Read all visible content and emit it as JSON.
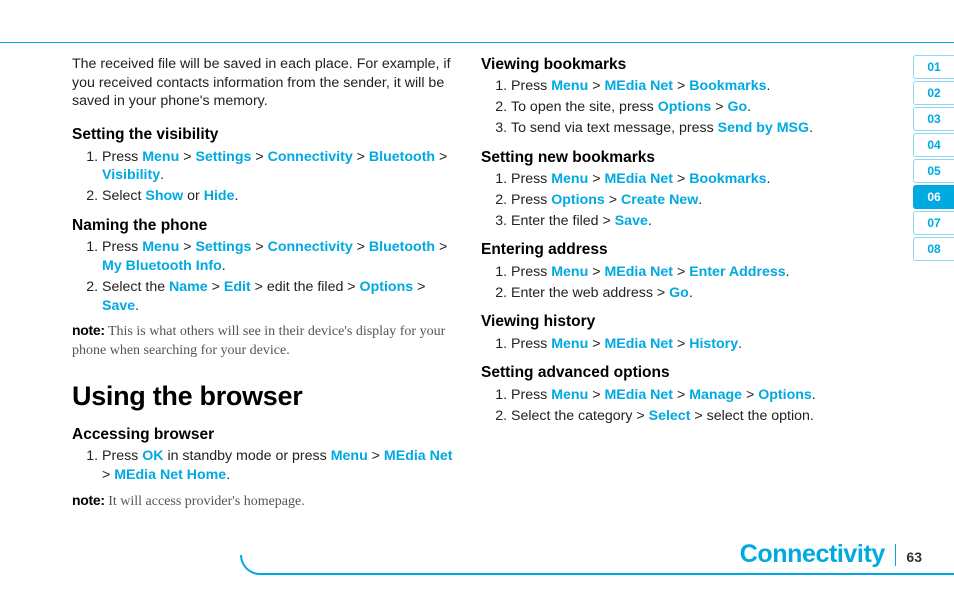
{
  "intro": "The received file will be saved in each place. For example, if you received contacts information from the sender, it will be saved in your phone's memory.",
  "left": {
    "visibility": {
      "head": "Setting the visibility",
      "s1_pre": "Press ",
      "s1_k1": "Menu",
      "s1_k2": "Settings",
      "s1_k3": "Connectivity",
      "s1_k4": "Bluetooth",
      "s1_k5": "Visibility",
      "s2_pre": "Select ",
      "s2_k1": "Show",
      "s2_or": " or ",
      "s2_k2": "Hide"
    },
    "naming": {
      "head": "Naming the phone",
      "s1_pre": "Press ",
      "s1_k1": "Menu",
      "s1_k2": "Settings",
      "s1_k3": "Connectivity",
      "s1_k4": "Bluetooth",
      "s1_k5": "My Bluetooth Info",
      "s2_pre": "Select the ",
      "s2_k1": "Name",
      "s2_k2": "Edit",
      "s2_mid": " > edit the filed > ",
      "s2_k3": "Options",
      "s2_k4": "Save",
      "note_label": "note:",
      "note": " This is what others will see in their device's display for your phone when searching for your device."
    },
    "browser_title": "Using the browser",
    "access": {
      "head": "Accessing browser",
      "s1_pre": "Press ",
      "s1_k1": "OK",
      "s1_mid": " in standby mode or press ",
      "s1_k2": "Menu",
      "s1_k3": "MEdia Net",
      "s1_k4": "MEdia Net Home",
      "note_label": "note:",
      "note": " It will access provider's homepage."
    }
  },
  "right": {
    "viewbm": {
      "head": "Viewing bookmarks",
      "s1_pre": "Press ",
      "s1_k1": "Menu",
      "s1_k2": "MEdia Net",
      "s1_k3": "Bookmarks",
      "s2_pre": "To open the site, press ",
      "s2_k1": "Options",
      "s2_k2": "Go",
      "s3_pre": "To send via text message, press ",
      "s3_k1": "Send by MSG"
    },
    "setbm": {
      "head": "Setting new bookmarks",
      "s1_pre": "Press ",
      "s1_k1": "Menu",
      "s1_k2": "MEdia Net",
      "s1_k3": "Bookmarks",
      "s2_pre": "Press ",
      "s2_k1": "Options",
      "s2_k2": "Create New",
      "s3_pre": "Enter the filed > ",
      "s3_k1": "Save"
    },
    "addr": {
      "head": "Entering address",
      "s1_pre": "Press ",
      "s1_k1": "Menu",
      "s1_k2": "MEdia Net",
      "s1_k3": "Enter Address",
      "s2_pre": "Enter the web address > ",
      "s2_k1": "Go"
    },
    "hist": {
      "head": "Viewing history",
      "s1_pre": "Press ",
      "s1_k1": "Menu",
      "s1_k2": "MEdia Net",
      "s1_k3": "History"
    },
    "adv": {
      "head": "Setting advanced options",
      "s1_pre": "Press ",
      "s1_k1": "Menu",
      "s1_k2": "MEdia Net",
      "s1_k3": "Manage",
      "s1_k4": "Options",
      "s2_pre": "Select the category > ",
      "s2_k1": "Select",
      "s2_post": " > select the option."
    }
  },
  "nav": {
    "items": [
      "01",
      "02",
      "03",
      "04",
      "05",
      "06",
      "07",
      "08"
    ],
    "active": "06"
  },
  "footer": {
    "category": "Connectivity",
    "page": "63"
  },
  "gt": " > ",
  "dot": "."
}
